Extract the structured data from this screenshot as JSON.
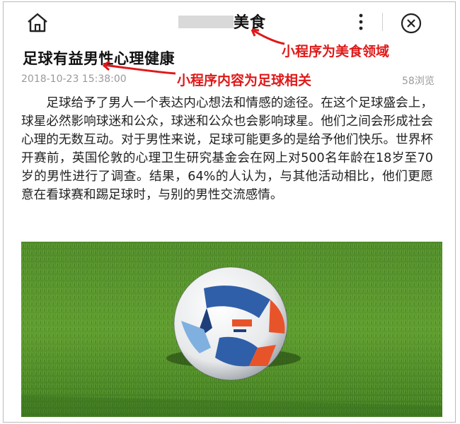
{
  "topbar": {
    "title": "美食",
    "icons": {
      "home": "home-icon",
      "more": "more-vertical-icon",
      "close": "close-circle-icon"
    }
  },
  "article": {
    "title": "足球有益男性心理健康",
    "date": "2018-10-23 15:38:00",
    "views": "58浏览",
    "body": "足球给予了男人一个表达内心想法和情感的途径。在这个足球盛会上，球星必然影响球迷和公众，球迷和公众也会影响球星。他们之间会形成社会心理的无数互动。对于男性来说，足球可能更多的是给予他们快乐。世界杯开赛前，英国伦敦的心理卫生研究基金会在网上对500名年龄在18岁至70岁的男性进行了调查。结果，64%的人认为，与其他活动相比，他们更愿意在看球赛和踢足球时，与别的男性交流感情。"
  },
  "annotations": {
    "domain_note": "小程序为美食领域",
    "content_note": "小程序内容为足球相关",
    "color": "#e01818"
  },
  "image": {
    "subject": "soccer-ball-on-grass",
    "watermark": ""
  }
}
